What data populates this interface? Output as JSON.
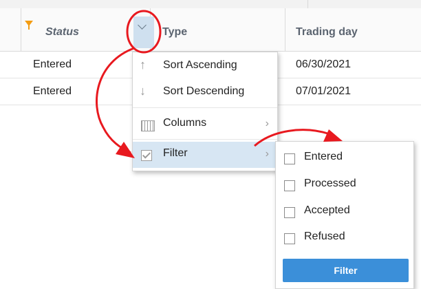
{
  "grid": {
    "columns": [
      {
        "label": "Status"
      },
      {
        "label": "Type"
      },
      {
        "label": "Trading day"
      }
    ],
    "rows": [
      {
        "status": "Entered",
        "trading_day": "06/30/2021"
      },
      {
        "status": "Entered",
        "trading_day": "07/01/2021"
      }
    ]
  },
  "column_menu": {
    "items": [
      {
        "label": "Sort Ascending",
        "icon": "arrow-up-icon"
      },
      {
        "label": "Sort Descending",
        "icon": "arrow-down-icon"
      },
      {
        "label": "Columns",
        "icon": "columns-icon"
      },
      {
        "label": "Filter",
        "icon": "checkbox-checked-icon"
      }
    ]
  },
  "filter_menu": {
    "options": [
      "Entered",
      "Processed",
      "Accepted",
      "Refused"
    ],
    "button_label": "Filter"
  },
  "colors": {
    "accent": "#3b8fd9",
    "highlight": "#d7e6f3",
    "annotation": "#e8191f",
    "filter_icon": "#f39c12"
  }
}
